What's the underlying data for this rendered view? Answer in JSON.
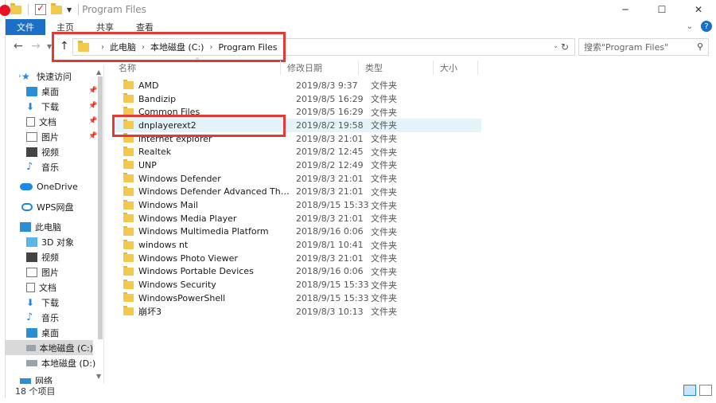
{
  "window": {
    "title": "Program Files"
  },
  "ribbon": {
    "tabs": [
      "文件",
      "主页",
      "共享",
      "查看"
    ]
  },
  "address": {
    "crumbs": [
      "此电脑",
      "本地磁盘 (C:)",
      "Program Files"
    ],
    "search_placeholder": "搜索\"Program Files\""
  },
  "sidebar": {
    "quick_access": "快速访问",
    "quick_items": [
      "桌面",
      "下载",
      "文档",
      "图片",
      "视频",
      "音乐"
    ],
    "onedrive": "OneDrive",
    "wps": "WPS网盘",
    "this_pc": "此电脑",
    "pc_items": [
      "3D 对象",
      "视频",
      "图片",
      "文档",
      "下载",
      "音乐",
      "桌面",
      "本地磁盘 (C:)",
      "本地磁盘 (D:)"
    ],
    "network": "网络"
  },
  "columns": {
    "name": "名称",
    "date": "修改日期",
    "type": "类型",
    "size": "大小"
  },
  "files": [
    {
      "name": "AMD",
      "date": "2019/8/3 9:37",
      "type": "文件夹"
    },
    {
      "name": "Bandizip",
      "date": "2019/8/5 16:29",
      "type": "文件夹"
    },
    {
      "name": "Common Files",
      "date": "2019/8/5 16:29",
      "type": "文件夹"
    },
    {
      "name": "dnplayerext2",
      "date": "2019/8/2 19:58",
      "type": "文件夹"
    },
    {
      "name": "internet explorer",
      "date": "2019/8/3 21:01",
      "type": "文件夹"
    },
    {
      "name": "Realtek",
      "date": "2019/8/2 12:45",
      "type": "文件夹"
    },
    {
      "name": "UNP",
      "date": "2019/8/2 12:49",
      "type": "文件夹"
    },
    {
      "name": "Windows Defender",
      "date": "2019/8/3 21:01",
      "type": "文件夹"
    },
    {
      "name": "Windows Defender Advanced Threat ...",
      "date": "2019/8/3 21:01",
      "type": "文件夹"
    },
    {
      "name": "Windows Mail",
      "date": "2018/9/15 15:33",
      "type": "文件夹"
    },
    {
      "name": "Windows Media Player",
      "date": "2019/8/3 21:01",
      "type": "文件夹"
    },
    {
      "name": "Windows Multimedia Platform",
      "date": "2018/9/16 0:06",
      "type": "文件夹"
    },
    {
      "name": "windows nt",
      "date": "2019/8/1 10:41",
      "type": "文件夹"
    },
    {
      "name": "Windows Photo Viewer",
      "date": "2019/8/3 21:01",
      "type": "文件夹"
    },
    {
      "name": "Windows Portable Devices",
      "date": "2018/9/16 0:06",
      "type": "文件夹"
    },
    {
      "name": "Windows Security",
      "date": "2018/9/15 15:33",
      "type": "文件夹"
    },
    {
      "name": "WindowsPowerShell",
      "date": "2018/9/15 15:33",
      "type": "文件夹"
    },
    {
      "name": "崩坏3",
      "date": "2019/8/3 10:13",
      "type": "文件夹"
    }
  ],
  "status": {
    "count": "18 个项目"
  },
  "accent": "#1b6fc6",
  "highlight_color": "#e53935"
}
